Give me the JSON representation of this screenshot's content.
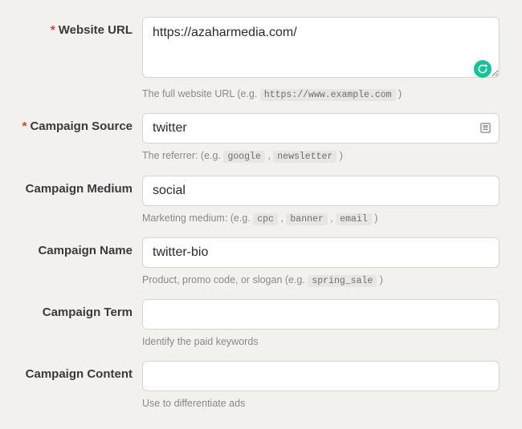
{
  "fields": {
    "url": {
      "label": "Website URL",
      "required": true,
      "value": "https://azaharmedia.com/",
      "helper_prefix": "The full website URL (e.g. ",
      "helper_code1": "https://www.example.com",
      "helper_suffix": " )"
    },
    "source": {
      "label": "Campaign Source",
      "required": true,
      "value": "twitter",
      "helper_prefix": "The referrer: (e.g. ",
      "helper_code1": "google",
      "helper_sep1": " , ",
      "helper_code2": "newsletter",
      "helper_suffix": " )"
    },
    "medium": {
      "label": "Campaign Medium",
      "required": false,
      "value": "social",
      "helper_prefix": "Marketing medium: (e.g. ",
      "helper_code1": "cpc",
      "helper_sep1": " , ",
      "helper_code2": "banner",
      "helper_sep2": " , ",
      "helper_code3": "email",
      "helper_suffix": " )"
    },
    "name": {
      "label": "Campaign Name",
      "required": false,
      "value": "twitter-bio",
      "helper_prefix": "Product, promo code, or slogan (e.g. ",
      "helper_code1": "spring_sale",
      "helper_suffix": " )"
    },
    "term": {
      "label": "Campaign Term",
      "required": false,
      "value": "",
      "helper_text": "Identify the paid keywords"
    },
    "content": {
      "label": "Campaign Content",
      "required": false,
      "value": "",
      "helper_text": "Use to differentiate ads"
    }
  },
  "symbols": {
    "asterisk": "*"
  }
}
